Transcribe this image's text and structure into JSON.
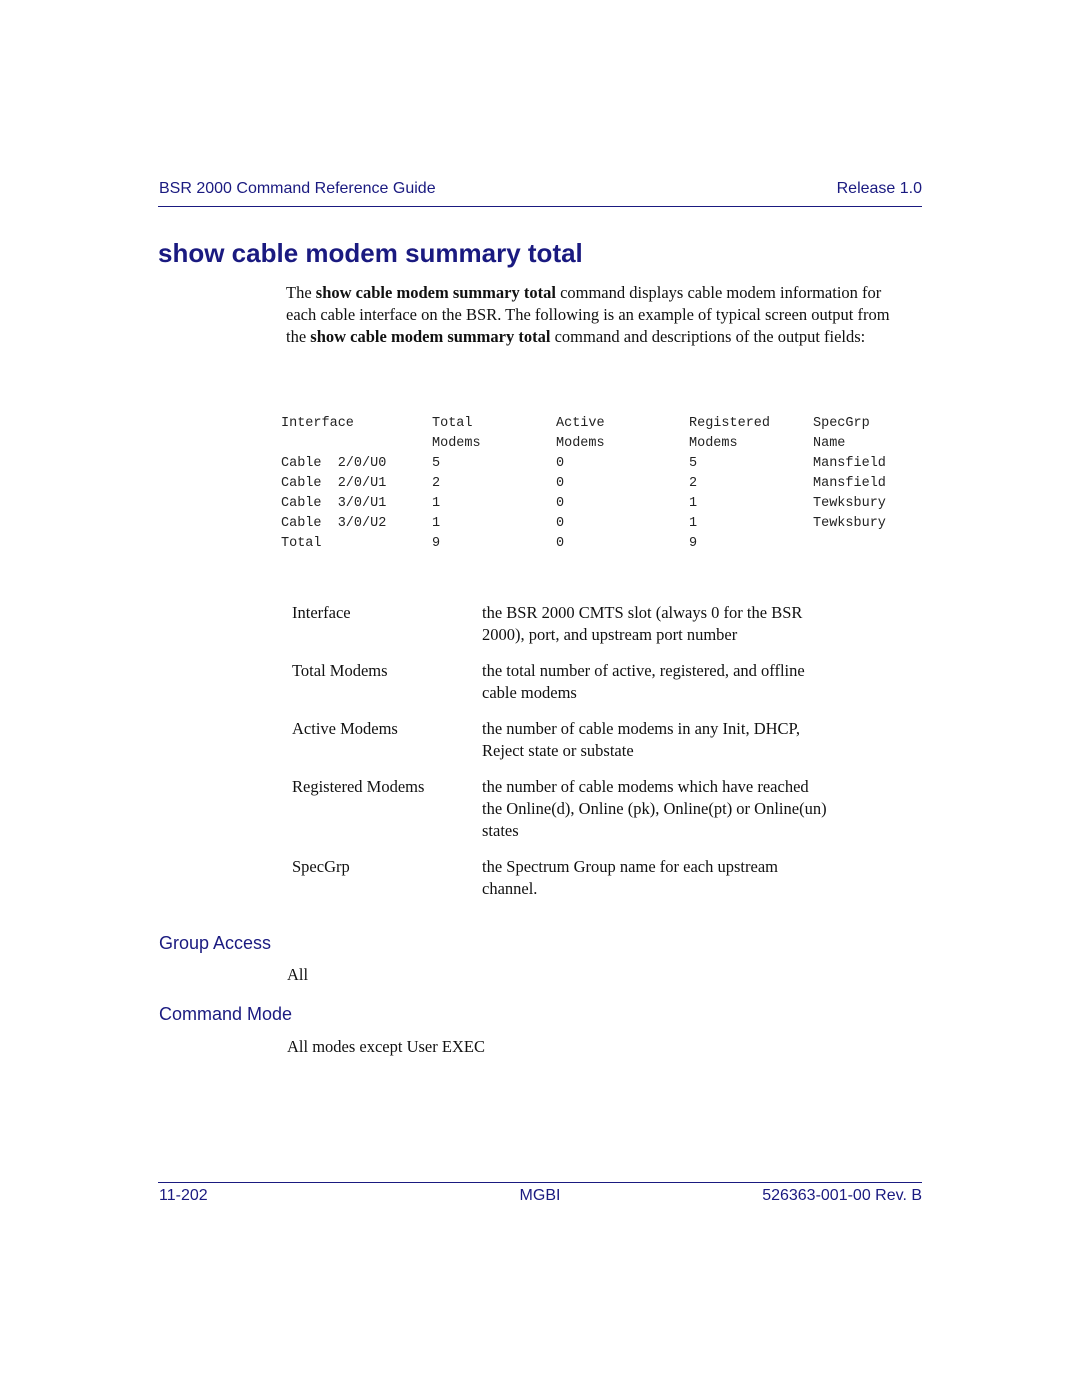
{
  "header": {
    "guide_title": "BSR 2000 Command Reference Guide",
    "release": "Release 1.0"
  },
  "page_title": "show cable modem summary total",
  "intro": {
    "p1": "The ",
    "b1": "show cable modem summary total",
    "p2": " command displays cable modem information for each cable interface on the BSR. The following is an example of typical screen output from the ",
    "b2": "show cable modem summary total",
    "p3": " command and descriptions of the output fields:"
  },
  "output_table": {
    "headers": [
      [
        "Interface",
        "Total",
        "Active",
        "Registered",
        "SpecGrp"
      ],
      [
        "",
        "Modems",
        "Modems",
        "Modems",
        "Name"
      ]
    ],
    "rows": [
      [
        "Cable  2/0/U0",
        "5",
        "0",
        "5",
        "Mansfield"
      ],
      [
        "Cable  2/0/U1",
        "2",
        "0",
        "2",
        "Mansfield"
      ],
      [
        "Cable  3/0/U1",
        "1",
        "0",
        "1",
        "Tewksbury"
      ],
      [
        "Cable  3/0/U2",
        "1",
        "0",
        "1",
        "Tewksbury"
      ],
      [
        "Total",
        "9",
        "0",
        "9",
        ""
      ]
    ]
  },
  "fields": [
    {
      "name": "Interface",
      "desc": "the BSR 2000 CMTS slot (always 0 for the BSR 2000), port, and upstream port number"
    },
    {
      "name": "Total Modems",
      "desc": "the total number of active, registered, and offline cable modems"
    },
    {
      "name": "Active Modems",
      "desc": "the number of cable modems in any Init, DHCP, Reject state or substate"
    },
    {
      "name": "Registered Modems",
      "desc": "the number of cable modems which have reached the Online(d), Online (pk), Online(pt) or Online(un) states"
    },
    {
      "name": "SpecGrp",
      "desc": "the Spectrum Group name for each upstream channel."
    }
  ],
  "group_access": {
    "heading": "Group Access",
    "value": "All"
  },
  "command_mode": {
    "heading": "Command Mode",
    "value": "All modes except User EXEC"
  },
  "footer": {
    "page_number": "11-202",
    "company": "MGBI",
    "doc_number": "526363-001-00 Rev. B"
  }
}
